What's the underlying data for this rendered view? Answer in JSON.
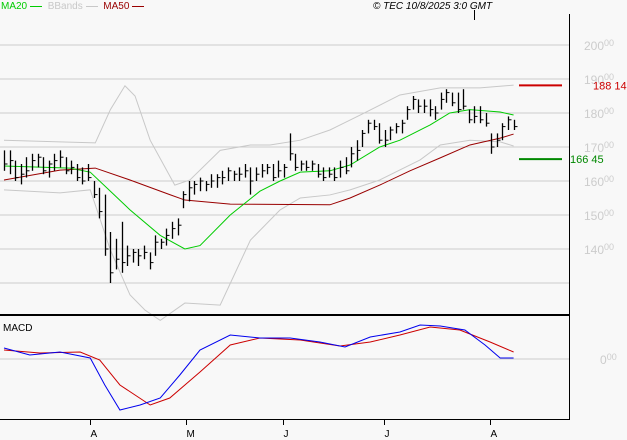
{
  "legend": [
    {
      "label": "MA20",
      "color": "#00cc00"
    },
    {
      "label": "BBands",
      "color": "#c8c8c8"
    },
    {
      "label": "MA50",
      "color": "#990000"
    }
  ],
  "copyright": "© TEC 10/8/2025 3:0 GMT",
  "markers": [
    {
      "label": "188 14",
      "value": 188.14,
      "color": "#cc0000"
    },
    {
      "label": "166 45",
      "value": 166.45,
      "color": "#008800"
    }
  ],
  "chart_data": {
    "type": "ohlc",
    "ylim": [
      122,
      204
    ],
    "y_ticks": [
      {
        "value": 200,
        "int": "200",
        "dec": "00"
      },
      {
        "value": 190,
        "int": "190",
        "dec": "00"
      },
      {
        "value": 180,
        "int": "180",
        "dec": "00"
      },
      {
        "value": 170,
        "int": "170",
        "dec": "00"
      },
      {
        "value": 160,
        "int": "160",
        "dec": "00"
      },
      {
        "value": 150,
        "int": "150",
        "dec": "00"
      },
      {
        "value": 140,
        "int": "140",
        "dec": "00"
      },
      {
        "value": 130,
        "int": "",
        "dec": ""
      }
    ],
    "x_ticks": [
      {
        "index": 15.4,
        "label": "A"
      },
      {
        "index": 32.5,
        "label": "M"
      },
      {
        "index": 49.8,
        "label": "J"
      },
      {
        "index": 67.9,
        "label": "J"
      },
      {
        "index": 86.8,
        "label": "A"
      }
    ],
    "bars_hlc": [
      [
        169,
        163,
        165
      ],
      [
        169,
        162,
        166
      ],
      [
        166,
        160,
        161
      ],
      [
        165,
        159,
        162
      ],
      [
        167,
        161,
        163
      ],
      [
        168,
        163,
        166
      ],
      [
        168,
        164,
        167
      ],
      [
        167,
        162,
        163
      ],
      [
        166,
        161,
        165
      ],
      [
        168,
        163,
        166
      ],
      [
        169,
        164,
        167
      ],
      [
        167,
        162,
        163
      ],
      [
        166,
        162,
        164
      ],
      [
        165,
        160,
        161
      ],
      [
        164,
        159,
        160
      ],
      [
        165,
        160,
        161
      ],
      [
        160,
        155,
        156
      ],
      [
        158,
        149,
        151
      ],
      [
        156,
        138,
        140
      ],
      [
        145,
        130,
        133
      ],
      [
        143,
        134,
        137
      ],
      [
        148,
        133,
        136
      ],
      [
        141,
        135,
        138
      ],
      [
        140,
        136,
        139
      ],
      [
        140,
        135,
        138
      ],
      [
        141,
        137,
        139
      ],
      [
        139,
        134,
        136
      ],
      [
        144,
        138,
        142
      ],
      [
        143,
        140,
        142
      ],
      [
        146,
        141,
        144
      ],
      [
        148,
        143,
        146
      ],
      [
        149,
        144,
        147
      ],
      [
        157,
        152,
        156
      ],
      [
        160,
        154,
        158
      ],
      [
        160,
        156,
        159
      ],
      [
        161,
        157,
        160
      ],
      [
        160,
        157,
        159
      ],
      [
        162,
        158,
        160
      ],
      [
        162,
        158,
        161
      ],
      [
        163,
        159,
        161
      ],
      [
        164,
        160,
        163
      ],
      [
        163,
        160,
        162
      ],
      [
        164,
        160,
        162
      ],
      [
        165,
        161,
        163
      ],
      [
        164,
        156,
        160
      ],
      [
        164,
        160,
        162
      ],
      [
        165,
        161,
        163
      ],
      [
        165,
        162,
        164
      ],
      [
        165,
        160,
        161
      ],
      [
        166,
        161,
        163
      ],
      [
        165,
        161,
        164
      ],
      [
        174,
        166,
        168
      ],
      [
        168,
        163,
        164
      ],
      [
        166,
        163,
        165
      ],
      [
        166,
        163,
        164
      ],
      [
        166,
        163,
        165
      ],
      [
        165,
        161,
        162
      ],
      [
        164,
        160,
        161
      ],
      [
        164,
        161,
        162
      ],
      [
        164,
        160,
        161
      ],
      [
        166,
        161,
        164
      ],
      [
        167,
        162,
        163
      ],
      [
        170,
        164,
        168
      ],
      [
        172,
        166,
        169
      ],
      [
        175,
        170,
        174
      ],
      [
        178,
        174,
        177
      ],
      [
        178,
        175,
        176
      ],
      [
        177,
        171,
        172
      ],
      [
        175,
        170,
        172
      ],
      [
        176,
        172,
        175
      ],
      [
        177,
        174,
        176
      ],
      [
        178,
        174,
        177
      ],
      [
        182,
        178,
        181
      ],
      [
        185,
        181,
        184
      ],
      [
        184,
        180,
        182
      ],
      [
        184,
        180,
        182
      ],
      [
        184,
        179,
        181
      ],
      [
        182,
        178,
        180
      ],
      [
        186,
        181,
        184
      ],
      [
        187,
        183,
        186
      ],
      [
        186,
        182,
        183
      ],
      [
        186,
        180,
        181
      ],
      [
        187,
        181,
        182
      ],
      [
        181,
        177,
        178
      ],
      [
        182,
        177,
        179
      ],
      [
        182,
        177,
        178
      ],
      [
        180,
        176,
        177
      ],
      [
        174,
        168,
        170
      ],
      [
        174,
        170,
        172
      ],
      [
        177,
        172,
        176
      ],
      [
        179,
        175,
        178
      ],
      [
        178,
        175,
        176
      ]
    ],
    "ma20": [
      [
        0,
        164.4
      ],
      [
        11.8,
        163.8
      ],
      [
        15.4,
        162.6
      ],
      [
        19,
        157
      ],
      [
        22.5,
        151.5
      ],
      [
        27.9,
        144
      ],
      [
        32.3,
        140
      ],
      [
        35,
        141
      ],
      [
        40.4,
        150
      ],
      [
        45.7,
        157
      ],
      [
        49.3,
        160
      ],
      [
        52.9,
        162.6
      ],
      [
        58.2,
        163
      ],
      [
        61.8,
        164.7
      ],
      [
        67.1,
        170
      ],
      [
        70.7,
        172
      ],
      [
        76.1,
        176.5
      ],
      [
        79.6,
        180
      ],
      [
        83.2,
        181
      ],
      [
        88.6,
        180.3
      ],
      [
        91,
        179.4
      ]
    ],
    "ma50": [
      [
        0,
        160.3
      ],
      [
        10,
        163.2
      ],
      [
        16.3,
        163.8
      ],
      [
        22.5,
        160.3
      ],
      [
        29.6,
        156
      ],
      [
        32.3,
        154.4
      ],
      [
        40.4,
        153.2
      ],
      [
        58.2,
        153
      ],
      [
        61.8,
        155
      ],
      [
        67.1,
        158.8
      ],
      [
        72.5,
        163
      ],
      [
        77.9,
        166.8
      ],
      [
        83.2,
        170.6
      ],
      [
        88.6,
        172.6
      ],
      [
        91,
        173.8
      ]
    ],
    "bb_upper": [
      [
        0,
        172
      ],
      [
        10,
        171.5
      ],
      [
        16.3,
        171.2
      ],
      [
        19,
        181
      ],
      [
        21.6,
        188
      ],
      [
        23.4,
        185
      ],
      [
        26.1,
        172
      ],
      [
        30.5,
        158.8
      ],
      [
        33.2,
        160.3
      ],
      [
        38.6,
        169
      ],
      [
        44,
        170.6
      ],
      [
        47.5,
        170.6
      ],
      [
        52.9,
        172
      ],
      [
        58.2,
        175
      ],
      [
        63.6,
        179.4
      ],
      [
        70.7,
        185.3
      ],
      [
        77.9,
        187.4
      ],
      [
        85,
        187.4
      ],
      [
        91,
        188.2
      ]
    ],
    "bb_lower": [
      [
        0,
        157.4
      ],
      [
        10,
        156.5
      ],
      [
        15.4,
        157.4
      ],
      [
        19,
        139.7
      ],
      [
        22.5,
        126.5
      ],
      [
        25.2,
        122
      ],
      [
        27.9,
        119
      ],
      [
        32.3,
        124.1
      ],
      [
        38.6,
        123.5
      ],
      [
        44,
        142.6
      ],
      [
        49.3,
        151.5
      ],
      [
        52.9,
        155
      ],
      [
        58.2,
        155.9
      ],
      [
        61.8,
        157.4
      ],
      [
        67.1,
        160.3
      ],
      [
        74.3,
        166.2
      ],
      [
        77.9,
        170.6
      ],
      [
        83.2,
        172
      ],
      [
        88.6,
        171.5
      ],
      [
        91,
        170.3
      ]
    ],
    "macd": {
      "title": "MACD",
      "zero_label": {
        "int": "0",
        "dec": "00"
      },
      "ylim": [
        -14,
        10
      ],
      "macd_line": [
        [
          0,
          2.75
        ],
        [
          4.6,
          1
        ],
        [
          10,
          1.75
        ],
        [
          15.4,
          0.25
        ],
        [
          18,
          -6.5
        ],
        [
          20.7,
          -12.75
        ],
        [
          24.3,
          -11.5
        ],
        [
          27.9,
          -9.75
        ],
        [
          31.4,
          -4
        ],
        [
          35,
          2.25
        ],
        [
          40.4,
          6
        ],
        [
          45.7,
          5.25
        ],
        [
          51.1,
          5.25
        ],
        [
          56.4,
          4.25
        ],
        [
          60.9,
          3
        ],
        [
          65.4,
          5.5
        ],
        [
          70.7,
          6.75
        ],
        [
          74.3,
          8.5
        ],
        [
          77.9,
          8.25
        ],
        [
          82.3,
          7.25
        ],
        [
          85.9,
          3.5
        ],
        [
          88.6,
          0.25
        ],
        [
          91,
          0.25
        ]
      ],
      "signal_line": [
        [
          0,
          2.25
        ],
        [
          6.4,
          1.5
        ],
        [
          13.6,
          1.75
        ],
        [
          17.1,
          -0.25
        ],
        [
          20.7,
          -6.5
        ],
        [
          26.1,
          -11.5
        ],
        [
          29.6,
          -9.75
        ],
        [
          35,
          -3.25
        ],
        [
          40.4,
          3.5
        ],
        [
          45.7,
          5.25
        ],
        [
          52.9,
          4.75
        ],
        [
          60,
          3.25
        ],
        [
          65.4,
          4.25
        ],
        [
          70.7,
          6
        ],
        [
          76.1,
          8
        ],
        [
          81.4,
          7.25
        ],
        [
          86.8,
          4.25
        ],
        [
          91,
          1.75
        ]
      ]
    }
  }
}
